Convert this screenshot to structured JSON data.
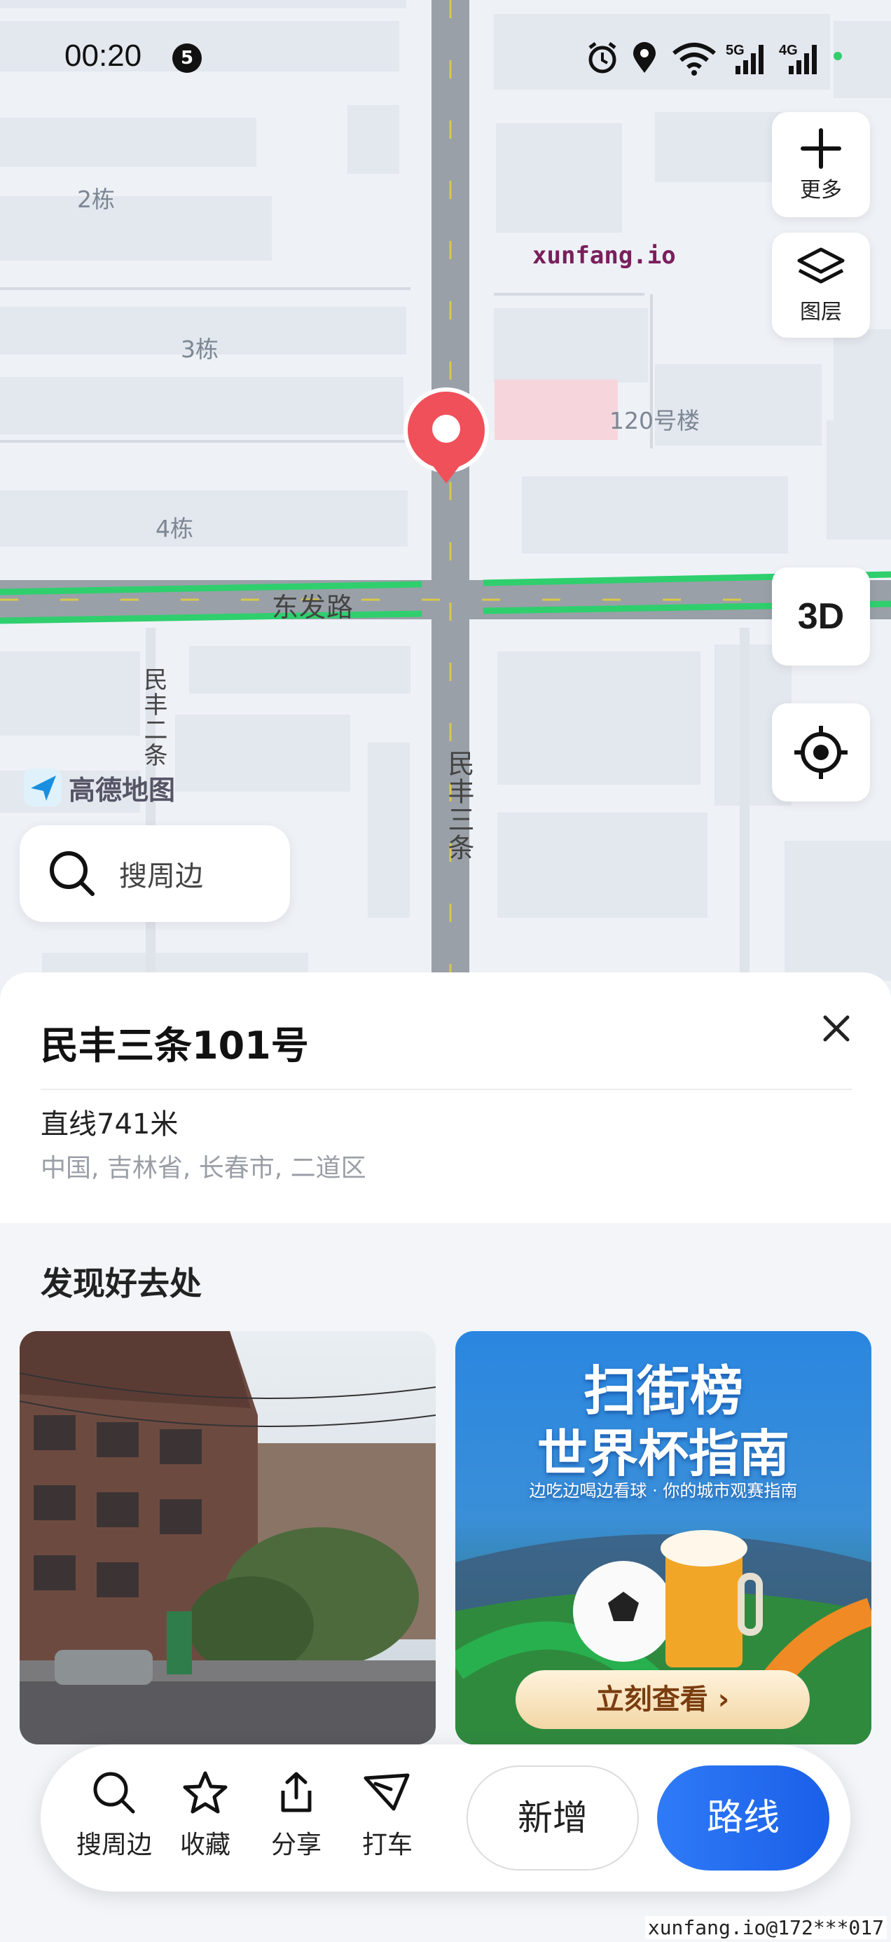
{
  "status_bar": {
    "time": "00:20",
    "notification_count": "5",
    "icons": [
      "alarm-icon",
      "location-icon",
      "wifi-icon",
      "signal-5g-icon",
      "signal-4g-icon"
    ]
  },
  "map": {
    "watermark": "xunfang.io",
    "labels": {
      "bldg_2": "2栋",
      "bldg_3": "3栋",
      "bldg_4": "4栋",
      "bldg_120": "120号楼",
      "road_dongfa": "东发路",
      "road_minfeng3": "民丰三条",
      "road_minfeng2": "民丰二条"
    },
    "controls": {
      "more_label": "更多",
      "layers_label": "图层",
      "three_d_label": "3D"
    },
    "logo_text": "高德地图",
    "search_nearby_label": "搜周边"
  },
  "place": {
    "title": "民丰三条101号",
    "distance": "直线741米",
    "address": "中国, 吉林省, 长春市, 二道区"
  },
  "discover": {
    "title": "发现好去处",
    "ad": {
      "title_line1": "扫街榜",
      "title_line2": "世界杯指南",
      "subtitle": "边吃边喝边看球 · 你的城市观赛指南",
      "button_label": "立刻查看 ›"
    }
  },
  "action_bar": {
    "search_label": "搜周边",
    "favorite_label": "收藏",
    "share_label": "分享",
    "taxi_label": "打车",
    "add_label": "新增",
    "route_label": "路线"
  },
  "footer_watermark": "xunfang.io@172***017",
  "colors": {
    "accent_blue": "#1a5fe8",
    "pin_red": "#f0505a",
    "traffic_green": "#2fcf6e"
  }
}
